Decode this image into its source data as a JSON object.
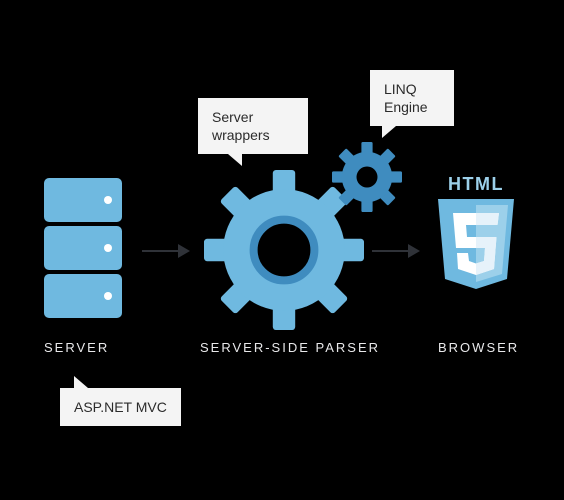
{
  "nodes": {
    "server": {
      "label": "SERVER"
    },
    "parser": {
      "label": "SERVER-SIDE PARSER"
    },
    "browser": {
      "label": "BROWSER"
    }
  },
  "callouts": {
    "aspnet": {
      "text": "ASP.NET MVC"
    },
    "wrappers": {
      "text_line1": "Server",
      "text_line2": "wrappers"
    },
    "linq": {
      "text_line1": "LINQ",
      "text_line2": "Engine"
    }
  },
  "html5": {
    "word": "HTML"
  },
  "colors": {
    "light_blue": "#6fb9e0",
    "dark_blue": "#3f8cbf",
    "pale_blue": "#9cd0ea",
    "callout_bg": "#f4f4f4",
    "arrow": "#2f3238"
  }
}
